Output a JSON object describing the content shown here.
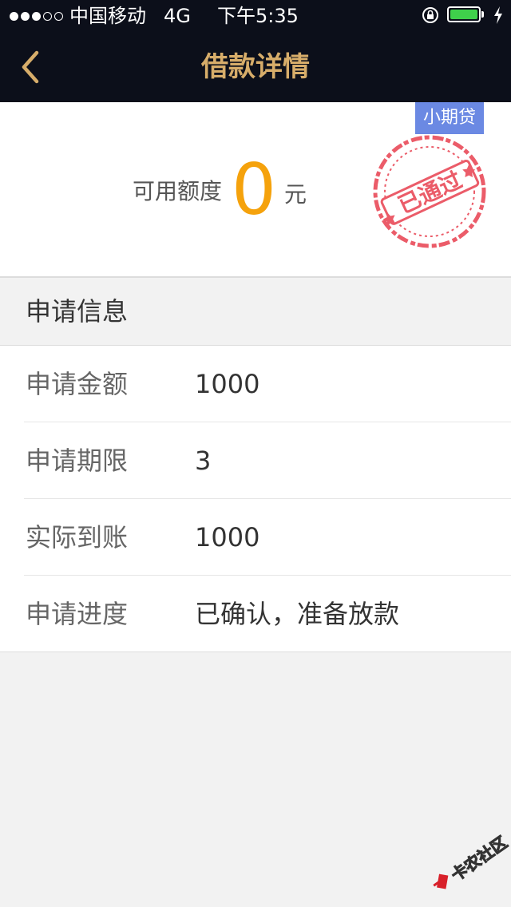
{
  "status_bar": {
    "signal_filled": 3,
    "signal_empty": 2,
    "carrier": "中国移动",
    "network": "4G",
    "time": "下午5:35",
    "battery_level": 1.0,
    "battery_color": "#3fd04b"
  },
  "nav": {
    "back_icon": "chevron-left-icon",
    "title": "借款详情",
    "title_color": "#d7ad6a",
    "background": "#0c0f1a"
  },
  "quota": {
    "tag": "小期贷",
    "label": "可用额度",
    "value": "0",
    "unit": "元",
    "value_color": "#f5a20c",
    "tag_color": "#6b89e3",
    "stamp_text": "已通过",
    "stamp_color": "#e8404f"
  },
  "section": {
    "title": "申请信息"
  },
  "info": {
    "rows": [
      {
        "label": "申请金额",
        "value": "1000"
      },
      {
        "label": "申请期限",
        "value": "3"
      },
      {
        "label": "实际到账",
        "value": "1000"
      },
      {
        "label": "申请进度",
        "value": "已确认，准备放款"
      }
    ]
  },
  "watermark": {
    "text": "卡农社区"
  }
}
